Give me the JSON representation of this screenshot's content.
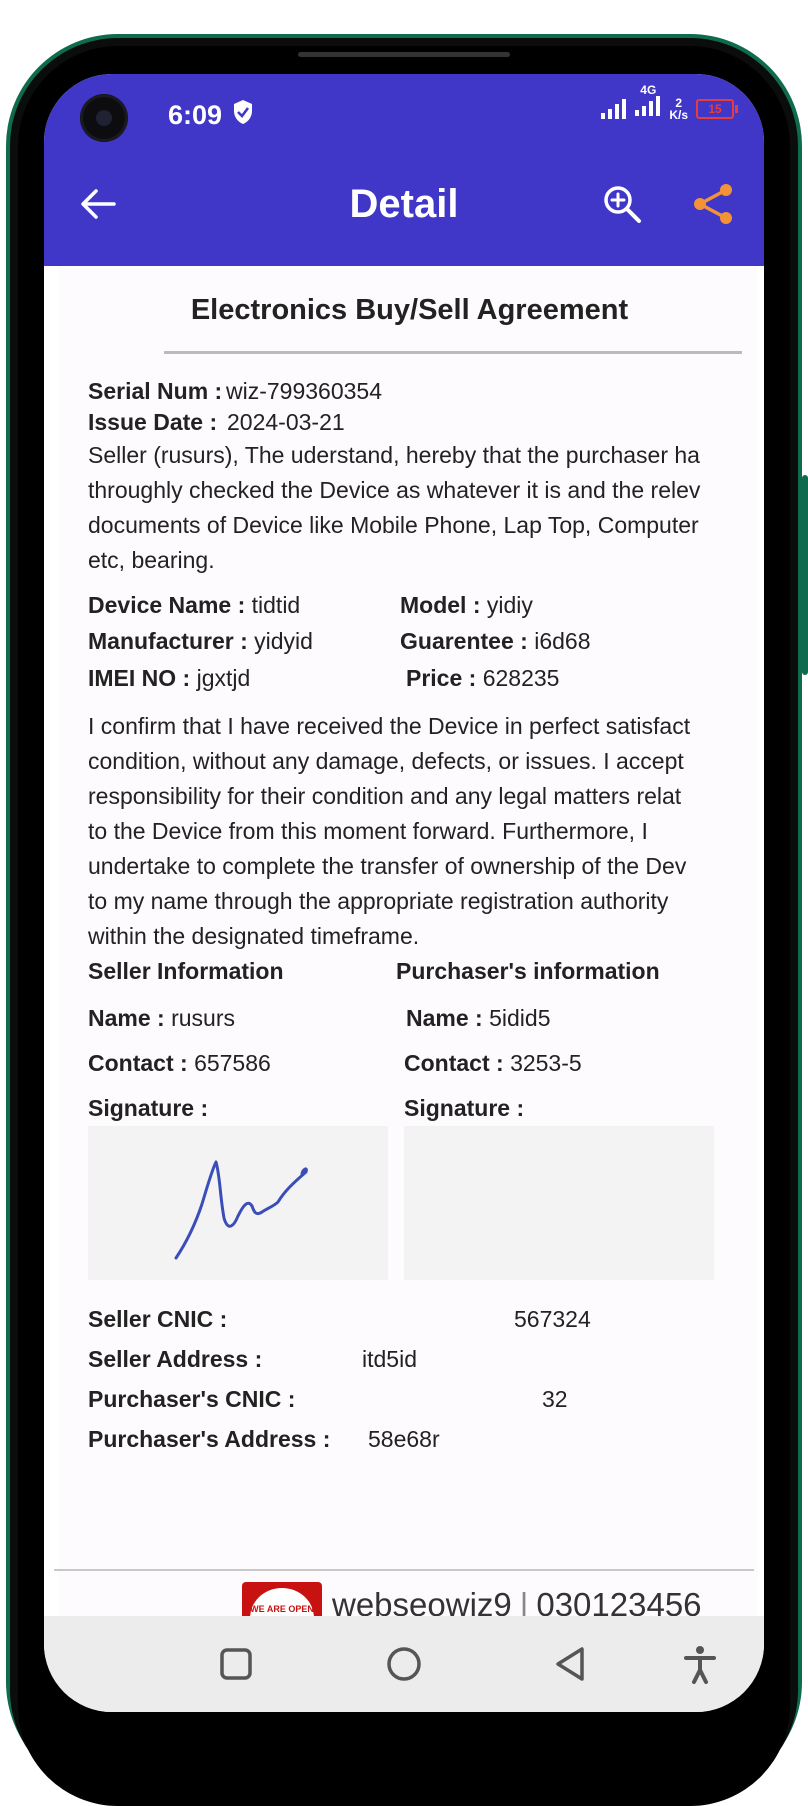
{
  "status_bar": {
    "time": "6:09",
    "network_type": "4G",
    "speed_value": "2",
    "speed_unit": "K/s",
    "battery": "15"
  },
  "appbar": {
    "title": "Detail"
  },
  "agreement": {
    "heading": "Electronics  Buy/Sell Agreement",
    "serial_label": "Serial Num :",
    "serial_value": "wiz-799360354",
    "issue_date_label": "Issue  Date :",
    "issue_date_value": "2024-03-21",
    "intro_lines": [
      "Seller (rusurs), The uderstand, hereby that the purchaser ha",
      "throughly checked the Device as whatever it is and the relev",
      "documents of Device like Mobile Phone, Lap Top, Computer",
      "etc, bearing."
    ],
    "device_name_label": "Device Name :",
    "device_name_value": "tidtid",
    "model_label": "Model :",
    "model_value": "yidiy",
    "manufacturer_label": "Manufacturer :",
    "manufacturer_value": "yidyid",
    "guarantee_label": "Guarentee :",
    "guarantee_value": "i6d68",
    "imei_label": "IMEI NO :",
    "imei_value": "jgxtjd",
    "price_label": "Price :",
    "price_value": "628235",
    "confirm_lines": [
      "I confirm that I have received the Device in perfect satisfact",
      "condition, without any damage, defects, or issues. I accept",
      "responsibility for their condition and any legal matters relat",
      "to the Device from this moment forward. Furthermore, I",
      "undertake to complete the transfer of ownership of the Dev",
      "to my name through the appropriate registration authority",
      "within the designated timeframe."
    ],
    "seller_info_title": "Seller Information",
    "purchaser_info_title": "Purchaser's information",
    "seller_name_label": "Name :",
    "seller_name_value": "rusurs",
    "purchaser_name_label": "Name :",
    "purchaser_name_value": "5idid5",
    "seller_contact_label": "Contact :",
    "seller_contact_value": "657586",
    "purchaser_contact_label": "Contact :",
    "purchaser_contact_value": "3253-5",
    "seller_signature_label": "Signature :",
    "purchaser_signature_label": "Signature :",
    "seller_cnic_label": "Seller CNIC :",
    "seller_cnic_value": "567324",
    "seller_address_label": "Seller Address :",
    "seller_address_value": "itd5id",
    "purchaser_cnic_label": "Purchaser's CNIC :",
    "purchaser_cnic_value": "32",
    "purchaser_address_label": "Purchaser's Address :",
    "purchaser_address_value": "58e68r"
  },
  "footer": {
    "logo_text": "WE ARE OPEN FOR",
    "company": "webseowiz9",
    "separator": "|",
    "phone": "030123456"
  },
  "icons": {
    "back": "arrow-left-icon",
    "zoom": "zoom-in-icon",
    "share": "share-icon",
    "nav_recent": "square-icon",
    "nav_home": "circle-icon",
    "nav_back": "triangle-back-icon",
    "accessibility": "accessibility-icon"
  },
  "colors": {
    "appbar": "#4037c8",
    "share_icon": "#f39236",
    "signature_ink": "#3b4db8",
    "frame": "#0f6b4e"
  }
}
